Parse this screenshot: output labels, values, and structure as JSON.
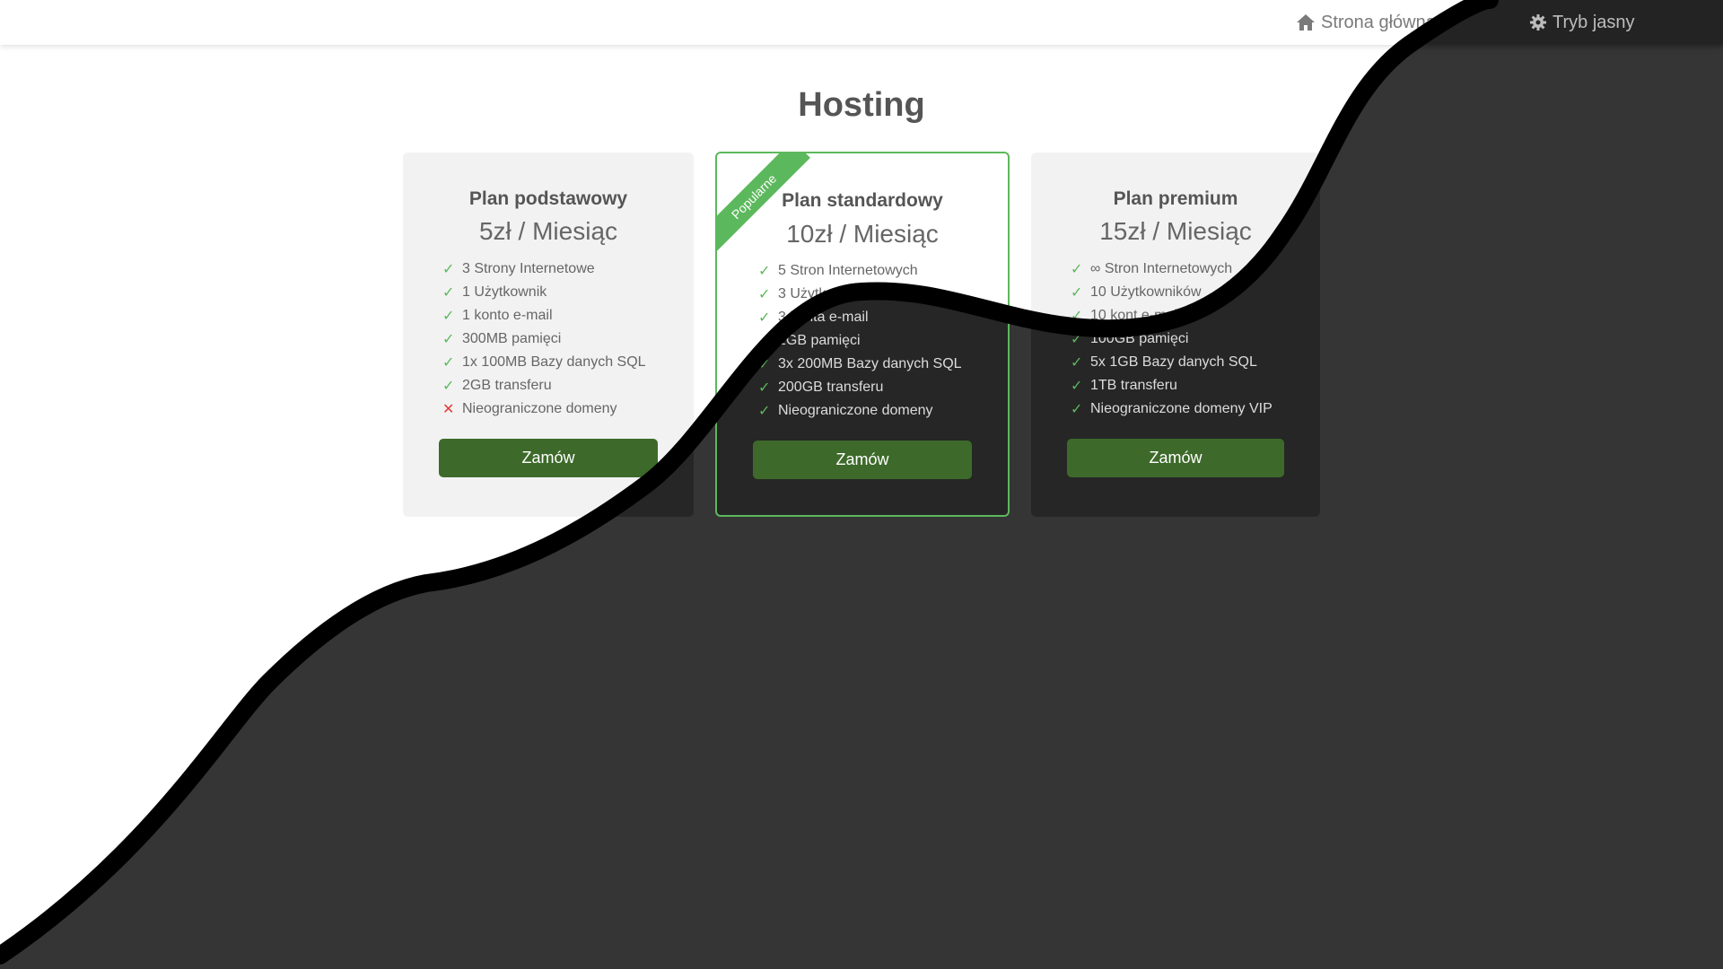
{
  "nav": {
    "home_label": "Strona główna",
    "theme_label": "Tryb jasny",
    "home_icon": "home-icon",
    "theme_icon": "gear-icon"
  },
  "page": {
    "title": "Hosting"
  },
  "colors": {
    "accent": "#5cb85c",
    "button": "#3d6a2a",
    "cross": "#e53935",
    "dark_bg": "#353535"
  },
  "plans": [
    {
      "name": "Plan podstawowy",
      "price": "5zł / Miesiąc",
      "features": [
        {
          "text": "3 Strony Internetowe",
          "included": true
        },
        {
          "text": "1 Użytkownik",
          "included": true
        },
        {
          "text": "1 konto e-mail",
          "included": true
        },
        {
          "text": "300MB pamięci",
          "included": true
        },
        {
          "text": "1x 100MB Bazy danych SQL",
          "included": true
        },
        {
          "text": "2GB transferu",
          "included": true
        },
        {
          "text": "Nieograniczone domeny",
          "included": false
        }
      ],
      "button": "Zamów"
    },
    {
      "name": "Plan standardowy",
      "price": "10zł / Miesiąc",
      "badge": "Popularne",
      "features": [
        {
          "text": "5 Stron Internetowych",
          "included": true
        },
        {
          "text": "3 Użytkowników",
          "included": true
        },
        {
          "text": "3 konta e-mail",
          "included": true
        },
        {
          "text": "1GB pamięci",
          "included": true
        },
        {
          "text": "3x 200MB Bazy danych SQL",
          "included": true
        },
        {
          "text": "200GB transferu",
          "included": true
        },
        {
          "text": "Nieograniczone domeny",
          "included": true
        }
      ],
      "button": "Zamów"
    },
    {
      "name": "Plan premium",
      "price": "15zł / Miesiąc",
      "features": [
        {
          "text": "∞ Stron Internetowych",
          "included": true
        },
        {
          "text": "10 Użytkowników",
          "included": true
        },
        {
          "text": "10 kont e-mail",
          "included": true
        },
        {
          "text": "100GB pamięci",
          "included": true
        },
        {
          "text": "5x 1GB Bazy danych SQL",
          "included": true
        },
        {
          "text": "1TB transferu",
          "included": true
        },
        {
          "text": "Nieograniczone domeny VIP",
          "included": true
        }
      ],
      "button": "Zamów"
    }
  ]
}
